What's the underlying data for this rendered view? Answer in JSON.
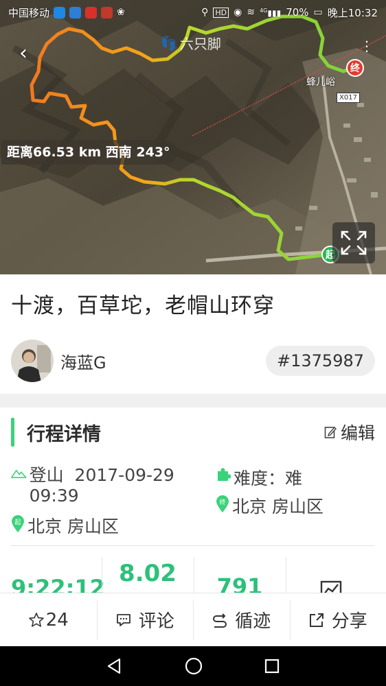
{
  "status_bar": {
    "carrier": "中国移动",
    "battery": "70%",
    "time": "晚上10:32",
    "network": "4G",
    "hd": "HD"
  },
  "map": {
    "brand": "六只脚",
    "place_label": "蜂儿峪",
    "road_badge": "X017",
    "distance_text": "距离66.53 km 西南 243°",
    "start_marker": "起",
    "end_marker": "终",
    "icons": [
      "back-icon",
      "more-icon",
      "expand-icon",
      "footprint-icon"
    ]
  },
  "trip": {
    "title": "十渡，百草坨，老帽山环穿",
    "author": "海蓝G",
    "id": "#1375987"
  },
  "section": {
    "title": "行程详情",
    "edit_label": "编辑"
  },
  "details": {
    "type_label": "登山",
    "datetime": "2017-09-29 09:39",
    "difficulty": "难度：难",
    "end_location": "北京  房山区",
    "start_location": "北京  房山区"
  },
  "stats": {
    "duration": "9:22:12",
    "distance": "8.02",
    "elevation": "791"
  },
  "actions": {
    "favorites_count": "24",
    "comment_label": "评论",
    "follow_label": "循迹",
    "share_label": "分享"
  },
  "colors": {
    "accent": "#3ad27a",
    "stat_green": "#2ec07a",
    "start_green": "#27b552",
    "end_red": "#e23b2f"
  }
}
